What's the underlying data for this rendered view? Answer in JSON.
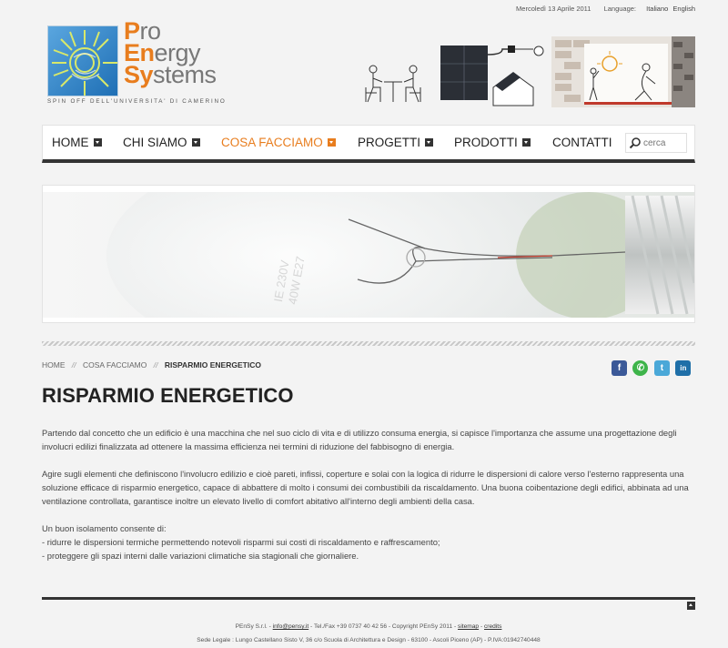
{
  "topbar": {
    "date": "Mercoledì 13 Aprile 2011",
    "language_label": "Language:",
    "languages": [
      "Italiano",
      "English"
    ]
  },
  "logo": {
    "line1_initial": "P",
    "line1_rest": "ro",
    "line2_initial": "En",
    "line2_rest": "ergy",
    "line3_initial": "Sy",
    "line3_rest": "stems",
    "tagline": "SPIN OFF DELL'UNIVERSITA' DI CAMERINO",
    "accent_color": "#e87d1e"
  },
  "nav": {
    "items": [
      {
        "label": "HOME",
        "has_dropdown": true
      },
      {
        "label": "CHI SIAMO",
        "has_dropdown": true
      },
      {
        "label": "COSA FACCIAMO",
        "has_dropdown": true,
        "active": true
      },
      {
        "label": "PROGETTI",
        "has_dropdown": true
      },
      {
        "label": "PRODOTTI",
        "has_dropdown": true
      },
      {
        "label": "CONTATTI",
        "has_dropdown": false
      }
    ],
    "search_placeholder": "cerca"
  },
  "breadcrumb": {
    "items": [
      "HOME",
      "COSA FACCIAMO"
    ],
    "separator": "//",
    "current": "RISPARMIO ENERGETICO"
  },
  "social": [
    "facebook-icon",
    "whatsapp-icon",
    "twitter-icon",
    "linkedin-icon"
  ],
  "page_title": "RISPARMIO ENERGETICO",
  "content": {
    "p1": "Partendo dal concetto che un edificio è una macchina che nel suo ciclo di vita e di utilizzo consuma energia, si capisce l'importanza che assume una progettazione degli involucri edilizi finalizzata ad ottenere la massima efficienza nei termini di riduzione del fabbisogno di energia.",
    "p2": "Agire sugli elementi che definiscono l'involucro edilizio e cioè pareti, infissi, coperture e solai con la logica di ridurre le dispersioni di calore verso l'esterno rappresenta una soluzione efficace di risparmio energetico, capace di abbattere di molto i consumi dei combustibili da riscaldamento. Una buona coibentazione degli edifici, abbinata ad una ventilazione controllata, garantisce inoltre un elevato livello di comfort abitativo all'interno degli ambienti della casa.",
    "list_intro": "Un buon isolamento consente di:",
    "bullets": [
      "- ridurre le dispersioni termiche permettendo notevoli risparmi sui costi di riscaldamento e raffrescamento;",
      "- proteggere gli spazi interni dalle variazioni climatiche sia stagionali che giornaliere."
    ]
  },
  "footer": {
    "company": "PEnSy S.r.l. -",
    "email": "info@pensy.it",
    "phone_copyright": "- Tel./Fax +39 0737 40 42 56 - Copyright PEnSy 2011 -",
    "sitemap": "sitemap",
    "dash": "-",
    "credits": "credits",
    "address": "Sede Legale : Lungo Castellano Sisto V, 36 c/o Scuola di Architettura e Design - 63100 - Ascoli Piceno (AP) - P.IVA:01942740448"
  }
}
